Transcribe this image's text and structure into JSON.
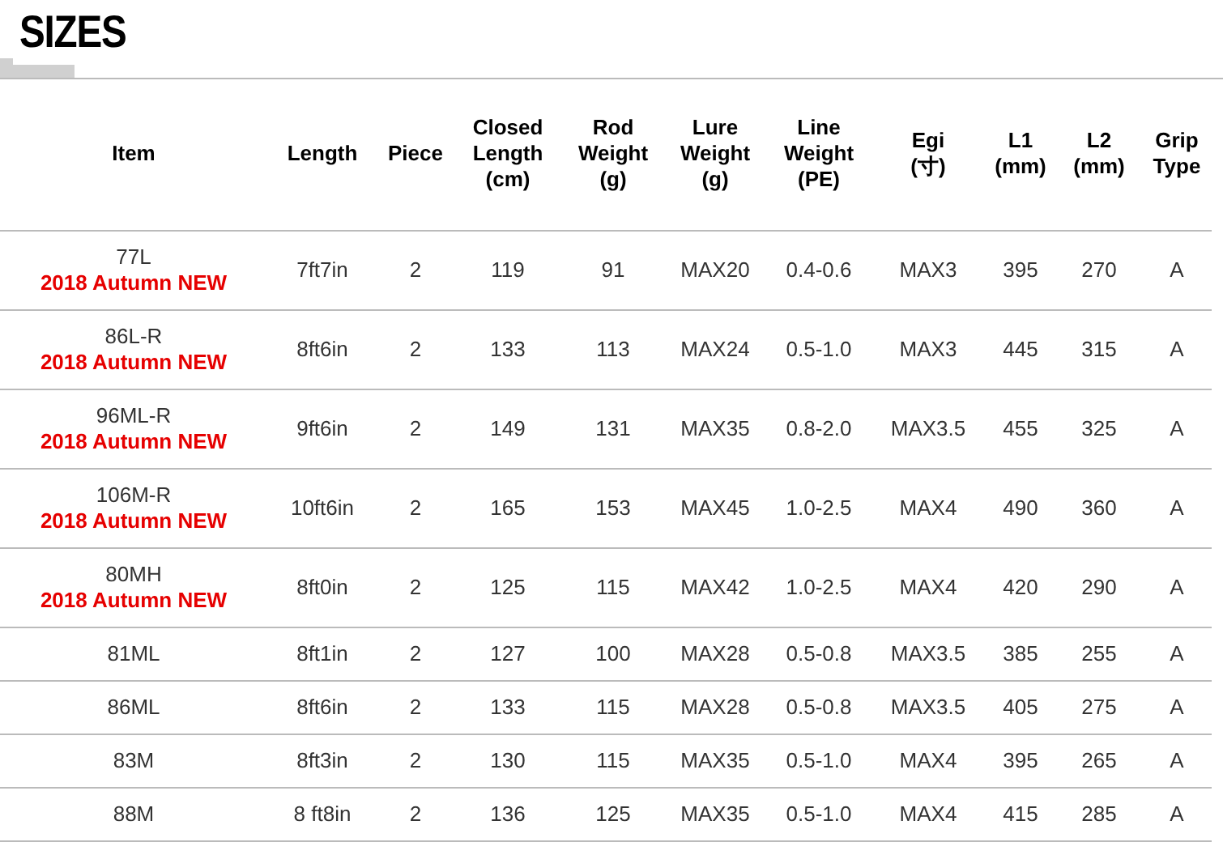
{
  "title": "SIZES",
  "table": {
    "columns": [
      "Item",
      "Length",
      "Piece",
      "Closed\nLength\n(cm)",
      "Rod\nWeight\n(g)",
      "Lure\nWeight\n(g)",
      "Line\nWeight\n(PE)",
      "Egi\n(寸)",
      "L1\n(mm)",
      "L2\n(mm)",
      "Grip\nType"
    ],
    "rows": [
      {
        "cells": [
          "77L",
          "7ft7in",
          "2",
          "119",
          "91",
          "MAX20",
          "0.4-0.6",
          "MAX3",
          "395",
          "270",
          "A"
        ],
        "badge": "2018 Autumn NEW"
      },
      {
        "cells": [
          "86L-R",
          "8ft6in",
          "2",
          "133",
          "113",
          "MAX24",
          "0.5-1.0",
          "MAX3",
          "445",
          "315",
          "A"
        ],
        "badge": "2018 Autumn NEW"
      },
      {
        "cells": [
          "96ML-R",
          "9ft6in",
          "2",
          "149",
          "131",
          "MAX35",
          "0.8-2.0",
          "MAX3.5",
          "455",
          "325",
          "A"
        ],
        "badge": "2018 Autumn NEW"
      },
      {
        "cells": [
          "106M-R",
          "10ft6in",
          "2",
          "165",
          "153",
          "MAX45",
          "1.0-2.5",
          "MAX4",
          "490",
          "360",
          "A"
        ],
        "badge": "2018 Autumn NEW"
      },
      {
        "cells": [
          "80MH",
          "8ft0in",
          "2",
          "125",
          "115",
          "MAX42",
          "1.0-2.5",
          "MAX4",
          "420",
          "290",
          "A"
        ],
        "badge": "2018 Autumn NEW"
      },
      {
        "cells": [
          "81ML",
          "8ft1in",
          "2",
          "127",
          "100",
          "MAX28",
          "0.5-0.8",
          "MAX3.5",
          "385",
          "255",
          "A"
        ]
      },
      {
        "cells": [
          "86ML",
          "8ft6in",
          "2",
          "133",
          "115",
          "MAX28",
          "0.5-0.8",
          "MAX3.5",
          "405",
          "275",
          "A"
        ]
      },
      {
        "cells": [
          "83M",
          "8ft3in",
          "2",
          "130",
          "115",
          "MAX35",
          "0.5-1.0",
          "MAX4",
          "395",
          "265",
          "A"
        ]
      },
      {
        "cells": [
          "88M",
          "8 ft8in",
          "2",
          "136",
          "125",
          "MAX35",
          "0.5-1.0",
          "MAX4",
          "415",
          "285",
          "A"
        ]
      }
    ]
  }
}
